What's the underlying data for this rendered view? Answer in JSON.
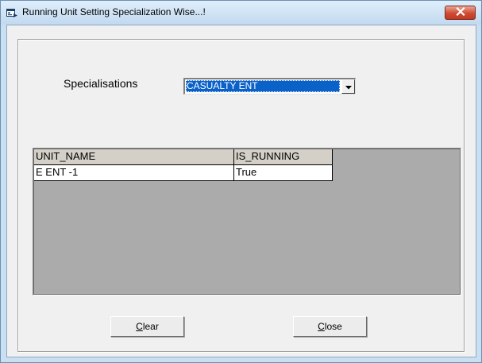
{
  "window": {
    "title": "Running Unit Setting Specialization Wise...!",
    "icons": {
      "app": "form-app-icon",
      "close": "close-icon"
    },
    "colors": {
      "selection": "#0a61c8",
      "close_button": "#cf4a32"
    }
  },
  "form": {
    "specialisations_label": "Specialisations",
    "specialisation_selected": "CASUALTY ENT"
  },
  "grid": {
    "columns": [
      "UNIT_NAME",
      "IS_RUNNING"
    ],
    "rows": [
      [
        "E ENT -1",
        "True"
      ]
    ]
  },
  "buttons": {
    "clear": {
      "mnemonic": "C",
      "rest": "lear"
    },
    "close": {
      "mnemonic": "C",
      "rest": "lose"
    }
  }
}
